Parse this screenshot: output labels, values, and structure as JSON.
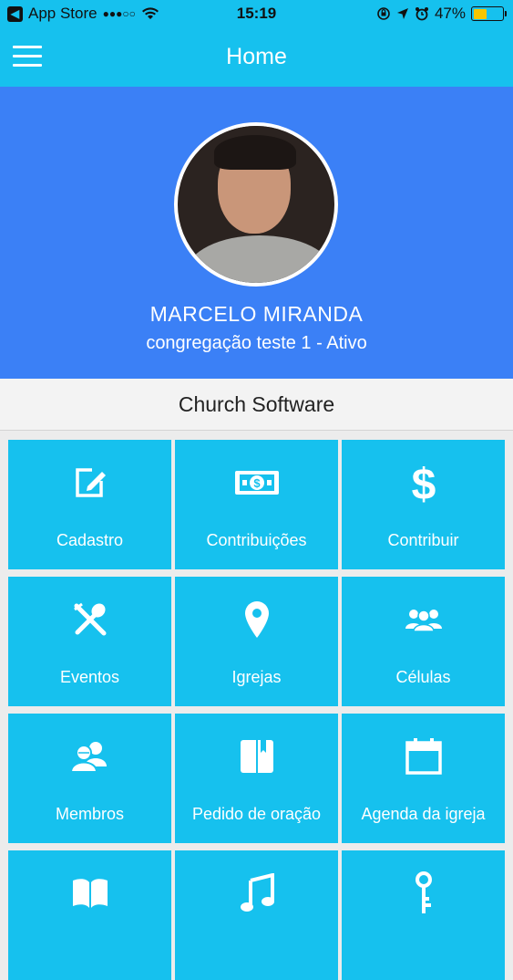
{
  "status_bar": {
    "back_app": "App Store",
    "signal": "●●●○○",
    "time": "15:19",
    "battery": "47%",
    "battery_level": 0.47
  },
  "nav": {
    "title": "Home"
  },
  "profile": {
    "name": "MARCELO MIRANDA",
    "subtitle": "congregação teste 1 - Ativo"
  },
  "section": {
    "title": "Church Software"
  },
  "tiles": [
    {
      "label": "Cadastro",
      "icon": "edit-icon"
    },
    {
      "label": "Contribuições",
      "icon": "money-bill-icon"
    },
    {
      "label": "Contribuir",
      "icon": "dollar-icon"
    },
    {
      "label": "Eventos",
      "icon": "utensils-icon"
    },
    {
      "label": "Igrejas",
      "icon": "map-pin-icon"
    },
    {
      "label": "Células",
      "icon": "group-icon"
    },
    {
      "label": "Membros",
      "icon": "users-icon"
    },
    {
      "label": "Pedido de oração",
      "icon": "prayer-book-icon"
    },
    {
      "label": "Agenda da igreja",
      "icon": "calendar-icon"
    },
    {
      "label": "",
      "icon": "open-book-icon"
    },
    {
      "label": "",
      "icon": "music-note-icon"
    },
    {
      "label": "",
      "icon": "key-icon"
    }
  ],
  "colors": {
    "primary": "#16c1ee",
    "profile_bg": "#3b80f6",
    "background": "#ececec"
  }
}
